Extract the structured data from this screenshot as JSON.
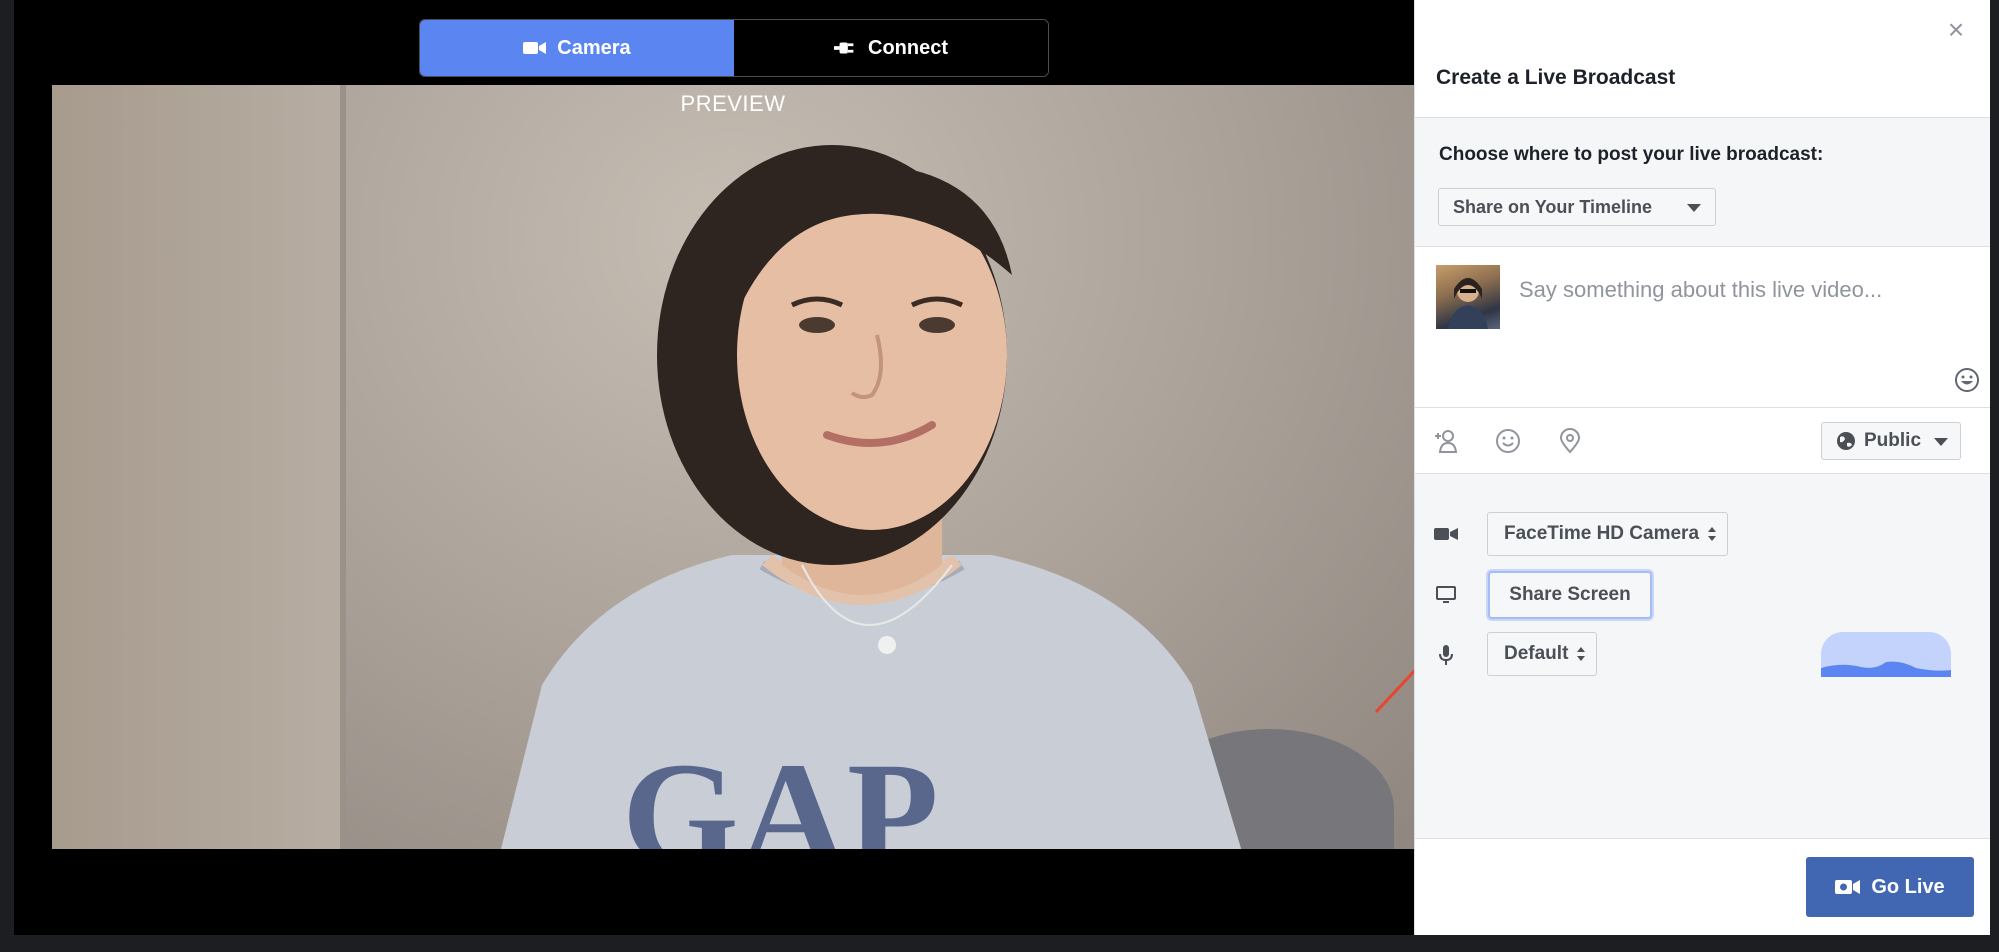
{
  "mode_toggle": {
    "camera_label": "Camera",
    "connect_label": "Connect",
    "active": "camera"
  },
  "preview": {
    "label": "PREVIEW"
  },
  "panel": {
    "title": "Create a Live Broadcast",
    "post_where_label": "Choose where to post your live broadcast:",
    "share_target": "Share on Your Timeline",
    "compose_placeholder": "Say something about this live video...",
    "audience": "Public",
    "devices": {
      "camera": "FaceTime HD Camera",
      "screen_button": "Share Screen",
      "microphone": "Default"
    },
    "go_live_label": "Go Live"
  },
  "colors": {
    "accent_blue": "#5b86f1",
    "go_live_blue": "#4267b2",
    "arrow_red": "#e8452e"
  }
}
